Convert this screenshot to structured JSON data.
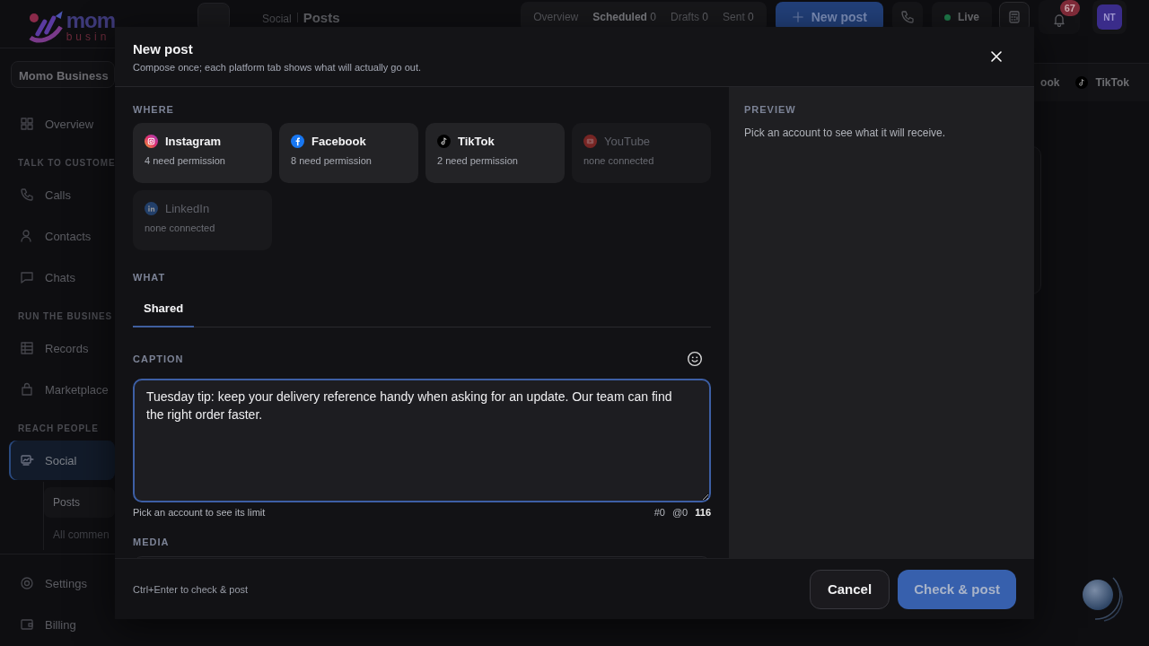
{
  "sidebar": {
    "logo": {
      "word": "mom",
      "tagline": "busin"
    },
    "workspace": "Momo Business",
    "sections": [
      {
        "items": [
          {
            "label": "Overview",
            "selected": false
          }
        ]
      },
      {
        "heading": "TALK TO CUSTOME",
        "items": [
          {
            "label": "Calls",
            "selected": false
          },
          {
            "label": "Contacts",
            "selected": false
          },
          {
            "label": "Chats",
            "selected": false
          }
        ]
      },
      {
        "heading": "RUN THE BUSINES",
        "items": [
          {
            "label": "Records",
            "selected": false
          },
          {
            "label": "Marketplace",
            "selected": false
          }
        ]
      },
      {
        "heading": "REACH PEOPLE",
        "items": [
          {
            "label": "Social",
            "selected": true,
            "children": [
              {
                "label": "Posts",
                "selected": true
              },
              {
                "label": "All commen",
                "selected": false
              }
            ]
          }
        ]
      }
    ],
    "bottom": [
      {
        "label": "Settings"
      },
      {
        "label": "Billing"
      }
    ]
  },
  "topbar": {
    "breadcrumb": [
      "Social",
      "Posts"
    ],
    "tabs": [
      {
        "label": "Overview",
        "selected": false
      },
      {
        "label": "Scheduled",
        "count": "0",
        "selected": true
      },
      {
        "label": "Drafts",
        "count": "0",
        "selected": false
      },
      {
        "label": "Sent",
        "count": "0",
        "selected": false
      }
    ],
    "new_post": "New post",
    "status": "Live",
    "notifications": "67",
    "avatar": "NT"
  },
  "content": {
    "chips": [
      {
        "label": "ook"
      },
      {
        "label": "TikTok"
      }
    ]
  },
  "modal": {
    "title": "New post",
    "subtitle": "Compose once; each platform tab shows what will actually go out.",
    "where": {
      "label": "WHERE",
      "accounts": [
        {
          "name": "Instagram",
          "status": "4 need permission",
          "disabled": false
        },
        {
          "name": "Facebook",
          "status": "8 need permission",
          "disabled": false
        },
        {
          "name": "TikTok",
          "status": "2 need permission",
          "disabled": false
        },
        {
          "name": "YouTube",
          "status": "none connected",
          "disabled": true
        },
        {
          "name": "LinkedIn",
          "status": "none connected",
          "disabled": true
        }
      ]
    },
    "what": {
      "label": "WHAT",
      "tabs": [
        {
          "label": "Shared",
          "selected": true
        }
      ]
    },
    "caption": {
      "label": "CAPTION",
      "value": "Tuesday tip: keep your delivery reference handy when asking for an update. Our team can find the right order faster.",
      "hint": "Pick an account to see its limit",
      "counters": [
        "#0",
        "@0"
      ],
      "count": "116"
    },
    "media": {
      "label": "MEDIA"
    },
    "preview": {
      "label": "PREVIEW",
      "text": "Pick an account to see what it will receive."
    },
    "footer": {
      "hint": "Ctrl+Enter to check & post",
      "buttons": [
        {
          "label": "Cancel",
          "kind": "secondary"
        },
        {
          "label": "Check & post",
          "kind": "primary"
        }
      ]
    }
  }
}
